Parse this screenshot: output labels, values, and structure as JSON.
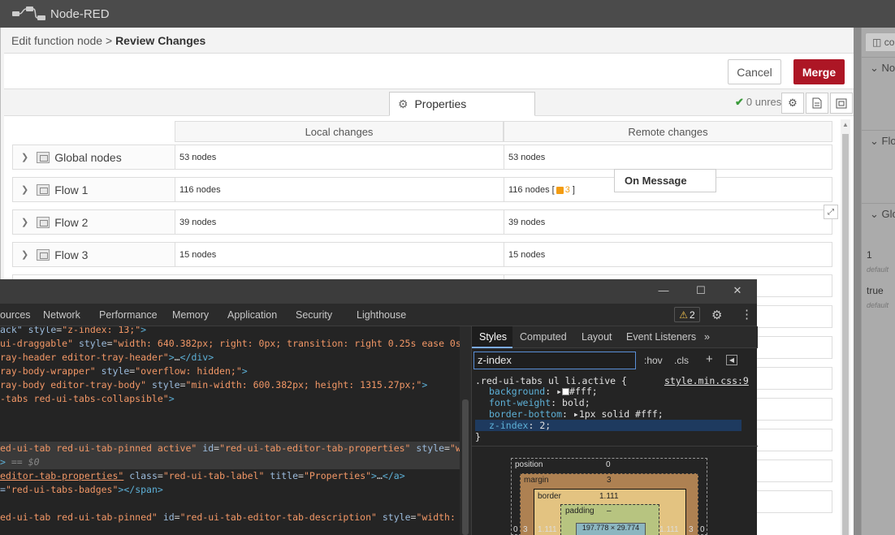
{
  "app": {
    "title": "Node-RED"
  },
  "tray": {
    "breadcrumb_parent": "Edit function node",
    "breadcrumb_sep": ">",
    "breadcrumb_current": "Review Changes",
    "cancel_label": "Cancel",
    "merge_label": "Merge",
    "tab_properties": "Properties",
    "unresolved_text": "0 unresolved",
    "col_local": "Local changes",
    "col_remote": "Remote changes",
    "tooltip": "On Message"
  },
  "rows": [
    {
      "name": "Global nodes",
      "local": "53 nodes",
      "remote": "53 nodes"
    },
    {
      "name": "Flow 1",
      "local": "116 nodes",
      "remote": "116 nodes",
      "remote_bracket_open": "[",
      "remote_badge": "3",
      "remote_bracket_close": "]"
    },
    {
      "name": "Flow 2",
      "local": "39 nodes",
      "remote": "39 nodes"
    },
    {
      "name": "Flow 3",
      "local": "15 nodes",
      "remote": "15 nodes"
    }
  ],
  "sidebar": {
    "tab_label": "co",
    "sections": [
      "No",
      "Flo",
      "Glo"
    ],
    "values": [
      {
        "value": "1",
        "sub": "default"
      },
      {
        "value": "true",
        "sub": "default"
      }
    ]
  },
  "devtools": {
    "tabs": [
      "ources",
      "Network",
      "Performance",
      "Memory",
      "Application",
      "Security",
      "Lighthouse"
    ],
    "warning_count": "2",
    "styles_tabs": [
      "Styles",
      "Computed",
      "Layout",
      "Event Listeners"
    ],
    "filter_value": "z-index",
    "hov": ":hov",
    "cls": ".cls",
    "rule": {
      "selector": ".red-ui-tabs ul li.active {",
      "source": "style.min.css:9",
      "props": [
        {
          "name": "background",
          "value": "#fff;"
        },
        {
          "name": "font-weight",
          "value": "bold;"
        },
        {
          "name": "border-bottom",
          "value": "1px solid #fff;"
        },
        {
          "name": "z-index",
          "value": "2;"
        }
      ],
      "close": "}"
    },
    "boxmodel": {
      "position_label": "position",
      "position_value": "0",
      "margin_label": "margin",
      "margin_value": "3",
      "border_label": "border",
      "border_value": "1.111",
      "padding_label": "padding",
      "padding_value": "–",
      "left_outer": "0",
      "left_margin": "3",
      "left_border": "1.111",
      "right_border": "1.111",
      "right_margin": "3",
      "right_outer": "0",
      "content": "197.778 × 29.774"
    }
  },
  "colors": {
    "merge": "#ad1625",
    "header": "#4b4b4b",
    "badge": "#f39c12"
  }
}
